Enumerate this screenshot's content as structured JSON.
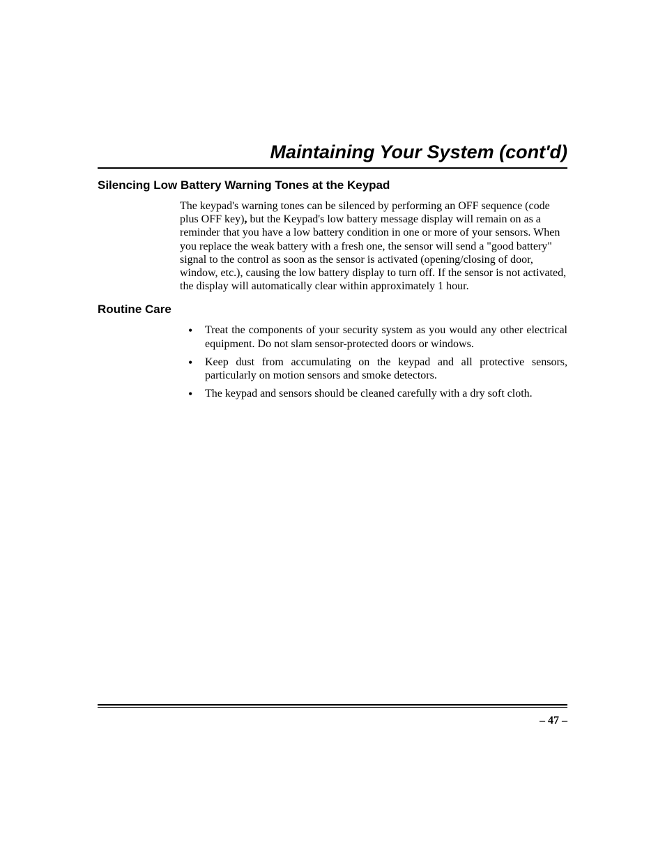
{
  "title": "Maintaining Your System (cont'd)",
  "sections": [
    {
      "heading": "Silencing Low Battery Warning Tones at the Keypad",
      "paragraph_parts": {
        "a": "The keypad's warning tones can be silenced by performing an OFF sequence (code plus OFF key)",
        "b": ",",
        "c": " but the Keypad's low battery message display will remain on as a reminder that you have a low battery condition in one or more of your sensors. When you replace the weak battery with a fresh one, the sensor will send a \"good battery\" signal to the control as soon as the sensor is activated (opening/closing of door, window, etc.), causing the low battery display to turn off. If the sensor is not activated, the display will automatically clear within approximately 1 hour."
      }
    },
    {
      "heading": "Routine Care",
      "bullets": [
        "Treat the components of your security system as you would any other electrical equipment. Do not slam sensor-protected doors or windows.",
        "Keep dust from accumulating on the keypad and all protective sensors, particularly on motion sensors and smoke detectors.",
        "The keypad and sensors should be cleaned carefully with a dry soft cloth."
      ]
    }
  ],
  "page_number": "– 47 –"
}
